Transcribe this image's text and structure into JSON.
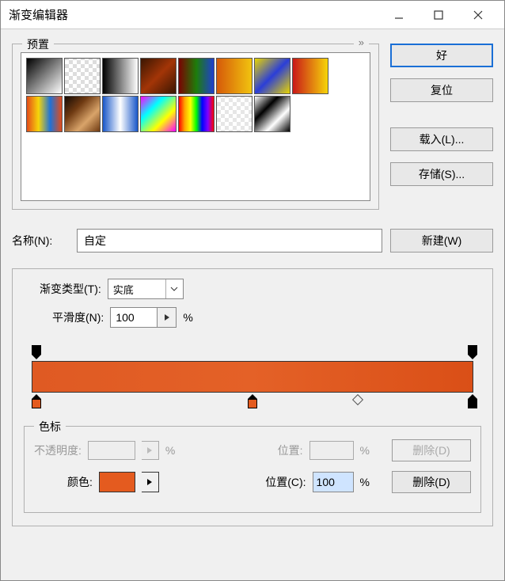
{
  "window": {
    "title": "渐变编辑器"
  },
  "presets": {
    "legend": "预置",
    "expand": "»",
    "swatches": [
      "linear-gradient(135deg,#000,#fff)",
      "repeating-conic-gradient(#fff 0 25%,#ddd 0 50%) 0/10px 10px, linear-gradient(90deg,#000,transparent)",
      "linear-gradient(90deg,#000,#fff)",
      "linear-gradient(135deg,#3a1602,#a33507,#3a1602)",
      "linear-gradient(90deg,#7b0202,#1e7d0a,#1f3fd0)",
      "linear-gradient(90deg,#d65a09,#f1c40f)",
      "linear-gradient(135deg,#e8d500,#2b3ed8,#e8d500)",
      "linear-gradient(90deg,#c91818,#f6d50a)",
      "linear-gradient(90deg,#e44b18,#f6d50a,#1f72d8,#e44b18)",
      "linear-gradient(135deg,#140a04,#6f3a12,#d9a46a,#6f3a12)",
      "linear-gradient(90deg,#1857c9,#fff,#1857c9)",
      "linear-gradient(135deg,#ff00ff,#00ffff,#ffff00,#ff00ff)",
      "linear-gradient(90deg,#ff0000,#ffa500,#ffff00,#00ff00,#0000ff,#8000ff,#ff0000)",
      "repeating-conic-gradient(#fff 0 25%,#e6e6e6 0 50%) 0/10px 10px, linear-gradient(135deg,rgba(255,255,255,0),rgba(255,255,255,0.9))",
      "linear-gradient(135deg,#fff,#000,#fff,#000)"
    ]
  },
  "buttons": {
    "ok": "好",
    "reset": "复位",
    "load": "载入(L)...",
    "save": "存储(S)...",
    "new": "新建(W)"
  },
  "name": {
    "label": "名称(N):",
    "value": "自定"
  },
  "gradient": {
    "type_label": "渐变类型(T):",
    "type_value": "实底",
    "smooth_label": "平滑度(N):",
    "smooth_value": "100",
    "percent": "%"
  },
  "stops": {
    "legend": "色标",
    "opacity_label": "不透明度:",
    "opacity_location_label": "位置:",
    "color_label": "颜色:",
    "color_hex": "#e45b1f",
    "location_label": "位置(C):",
    "location_value": "100",
    "delete_label": "删除(D)"
  }
}
